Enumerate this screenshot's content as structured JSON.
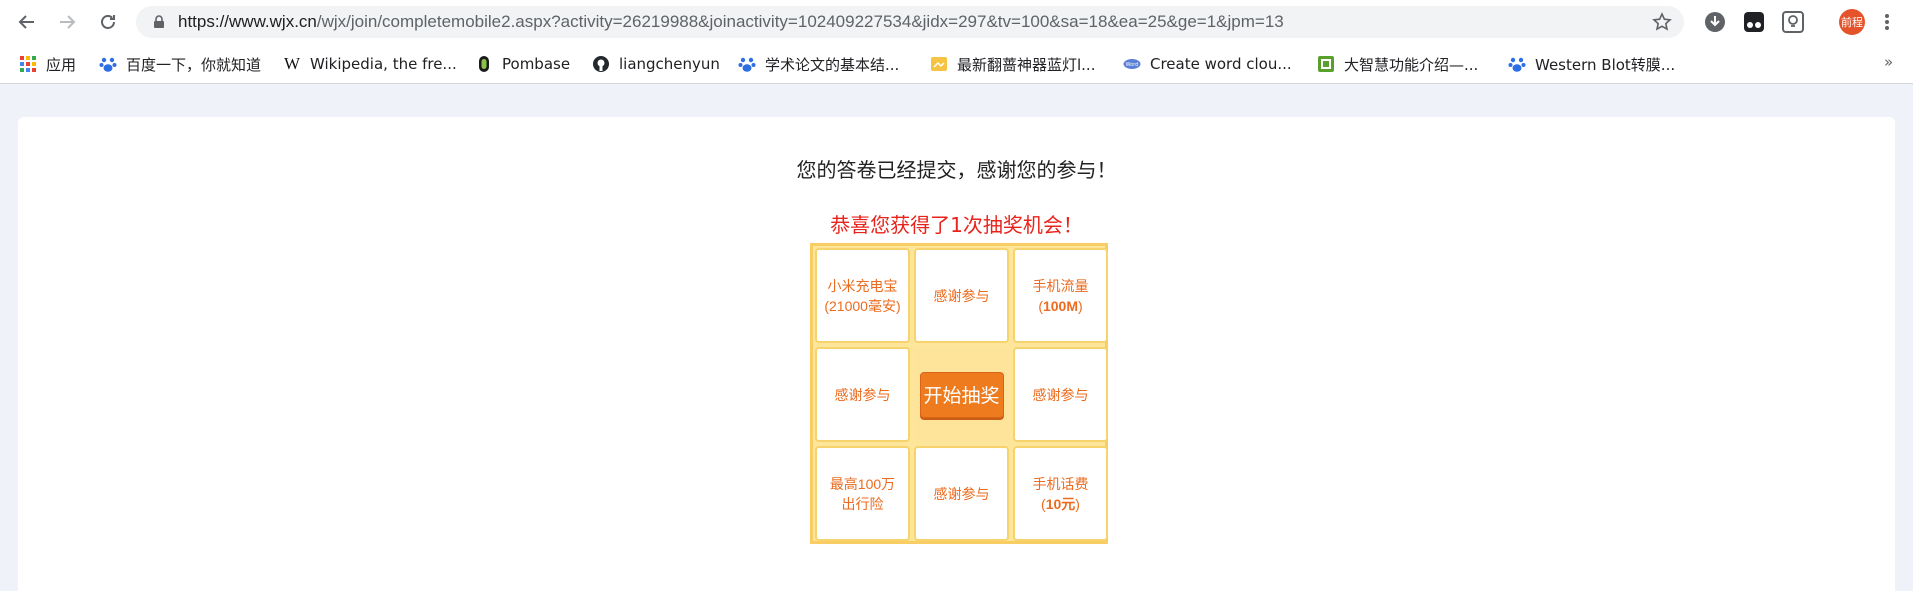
{
  "browser": {
    "url_host": "https://www.wjx.cn",
    "url_rest": "/wjx/join/completemobile2.aspx?activity=26219988&joinactivity=102409227534&jidx=297&tv=100&sa=18&ea=25&ge=1&jpm=13",
    "profile_label": "前程"
  },
  "bookmarks": [
    {
      "label": "应用",
      "icon": "apps-grid-icon"
    },
    {
      "label": "百度一下，你就知道",
      "icon": "baidu-paw-icon"
    },
    {
      "label": "Wikipedia, the fre...",
      "icon": "wikipedia-w-icon"
    },
    {
      "label": "Pombase",
      "icon": "pombase-icon"
    },
    {
      "label": "liangchenyun",
      "icon": "github-icon"
    },
    {
      "label": "学术论文的基本结...",
      "icon": "baidu-paw-icon"
    },
    {
      "label": "最新翻蔷神器蓝灯l...",
      "icon": "lantern-icon"
    },
    {
      "label": "Create word clou...",
      "icon": "word-cloud-icon"
    },
    {
      "label": "大智慧功能介绍—...",
      "icon": "dzh-icon"
    },
    {
      "label": "Western Blot转膜...",
      "icon": "baidu-paw-icon"
    }
  ],
  "bookmarks_more": "»",
  "page": {
    "thanks": "您的答卷已经提交，感谢您的参与！",
    "congrats": "恭喜您获得了1次抽奖机会！",
    "prizes": {
      "p0_line1": "小米充电宝",
      "p0_line2": "(21000毫安)",
      "p1": "感谢参与",
      "p2_line1": "手机流量",
      "p2_line2_prefix": "(",
      "p2_line2_bold": "100M",
      "p2_line2_suffix": ")",
      "p3": "感谢参与",
      "p4": "感谢参与",
      "p5_line1": "最高100万",
      "p5_line2": "出行险",
      "p6": "感谢参与",
      "p7_line1": "手机话费",
      "p7_line2_prefix": "(",
      "p7_line2_bold": "10元",
      "p7_line2_suffix": ")"
    },
    "start_button": "开始抽奖"
  }
}
